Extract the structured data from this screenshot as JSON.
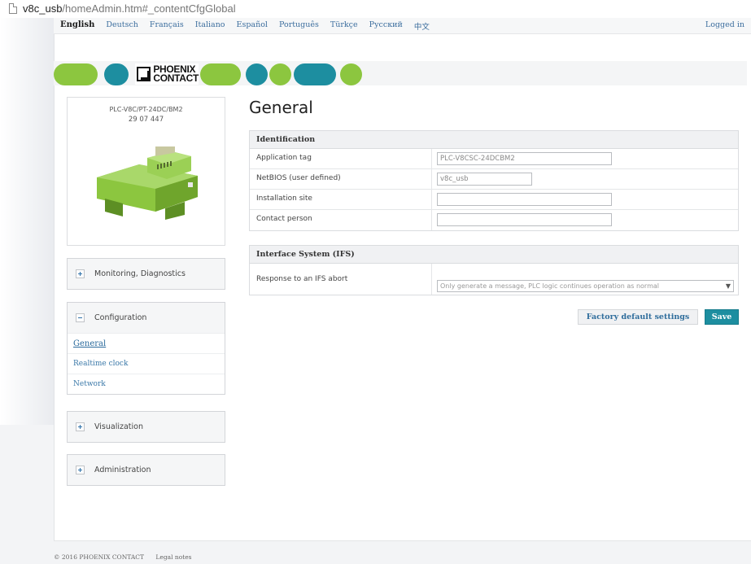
{
  "address_bar": {
    "url_host": "v8c_usb",
    "url_path": "/homeAdmin.htm#_contentCfgGlobal"
  },
  "language_bar": {
    "languages": [
      "English",
      "Deutsch",
      "Français",
      "Italiano",
      "Español",
      "Português",
      "Türkçe",
      "Русский",
      "中文"
    ],
    "active": "English",
    "status": "Logged in"
  },
  "brand": {
    "logo_line1": "PHOENIX",
    "logo_line2": "CONTACT",
    "colors": {
      "green": "#8cc63f",
      "teal": "#1d8ea0",
      "band": "#f4f5f6"
    }
  },
  "product": {
    "name": "PLC-V8C/PT-24DC/BM2",
    "number": "29 07 447"
  },
  "sidebar": {
    "monitoring": "Monitoring, Diagnostics",
    "configuration": "Configuration",
    "configuration_items": [
      "General",
      "Realtime clock",
      "Network"
    ],
    "visualization": "Visualization",
    "administration": "Administration"
  },
  "page": {
    "title": "General"
  },
  "identification": {
    "heading": "Identification",
    "application_tag_label": "Application tag",
    "application_tag_value": "PLC-V8CSC-24DCBM2",
    "netbios_label": "NetBIOS (user defined)",
    "netbios_value": "v8c_usb",
    "installation_site_label": "Installation site",
    "installation_site_value": "",
    "contact_person_label": "Contact person",
    "contact_person_value": ""
  },
  "ifs": {
    "heading": "Interface System (IFS)",
    "response_label": "Response to an IFS abort",
    "response_value": "Only generate a message, PLC logic continues operation as normal"
  },
  "buttons": {
    "factory_default": "Factory default settings",
    "save": "Save"
  },
  "footer": {
    "copyright": "© 2016 PHOENIX CONTACT",
    "legal": "Legal notes"
  }
}
